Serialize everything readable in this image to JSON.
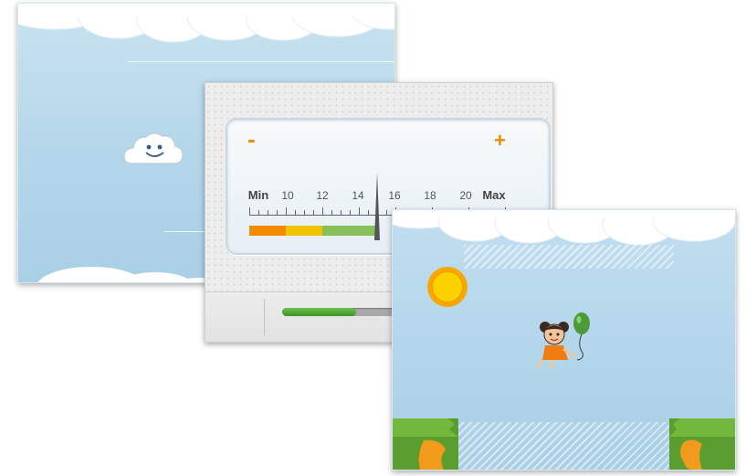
{
  "screens": {
    "cloud_screen": {
      "icon": "smiling-cloud-icon"
    },
    "gauge_panel": {
      "minus_label": "-",
      "plus_label": "+",
      "scale_labels": [
        "Min",
        "10",
        "12",
        "14",
        "16",
        "18",
        "20",
        "Max"
      ],
      "needle_value": 15,
      "scale_range": [
        8,
        22
      ],
      "color_bands": [
        {
          "color": "#f38b00",
          "from": 8,
          "to": 10
        },
        {
          "color": "#f2c300",
          "from": 10,
          "to": 12
        },
        {
          "color": "#88c05c",
          "from": 12,
          "to": 15
        }
      ],
      "progress_fraction": 0.58,
      "progress_color": "#4fa832"
    },
    "balloon_game": {
      "sun_icon": "sun-icon",
      "character_icon": "girl-with-balloon-icon",
      "balloon_color": "#4c9a3a"
    }
  },
  "colors": {
    "sky": "#b4d6ea",
    "accent": "#f08a00",
    "grass": "#5b9e2f"
  }
}
